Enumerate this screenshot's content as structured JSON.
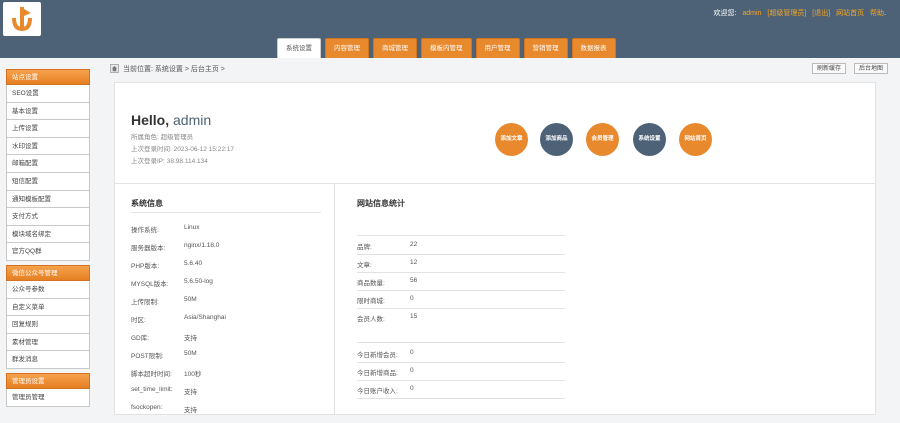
{
  "header": {
    "welcome": "欢迎您:",
    "user": "admin",
    "role_link": "[超级管理员]",
    "logout_link": "[退出]",
    "site_home_link": "网站首页",
    "help_link": "帮助"
  },
  "tabs": [
    {
      "label": "系统设置",
      "active": true
    },
    {
      "label": "内容管理"
    },
    {
      "label": "商城管理"
    },
    {
      "label": "模板内管理"
    },
    {
      "label": "用户管理"
    },
    {
      "label": "营销管理"
    },
    {
      "label": "数据报表"
    }
  ],
  "sidebar": {
    "groups": [
      {
        "title": "站点设置",
        "items": [
          "SEO设置",
          "基本设置",
          "上传设置",
          "水印设置",
          "邮箱配置",
          "短信配置",
          "通知模板配置",
          "支付方式",
          "模块域名绑定",
          "官方QQ群"
        ]
      },
      {
        "title": "微信公众号管理",
        "items": [
          "公众号参数",
          "自定义菜单",
          "回复规则",
          "素材管理",
          "群发消息"
        ]
      },
      {
        "title": "管理员设置",
        "items": [
          "管理员管理"
        ]
      }
    ]
  },
  "breadcrumb": {
    "text": "当前位置: 系统设置 > 后台主页 >",
    "btn_refresh": "刷新缓存",
    "btn_map": "后台地图"
  },
  "welcome": {
    "hello": "Hello,",
    "username": "admin",
    "role": "所属角色: 超级管理员",
    "last_login_time": "上次登录时间: 2023-06-12 15:22:17",
    "last_login_ip": "上次登录IP: 38.98.114.134"
  },
  "quick_actions": [
    {
      "label": "添加文章",
      "color": "orange"
    },
    {
      "label": "添加商品",
      "color": "slate"
    },
    {
      "label": "会员管理",
      "color": "orange"
    },
    {
      "label": "系统设置",
      "color": "slate"
    },
    {
      "label": "网站首页",
      "color": "orange"
    }
  ],
  "system_info": {
    "title": "系统信息",
    "rows": [
      {
        "k": "操作系统:",
        "v": "Linux"
      },
      {
        "k": "服务器版本:",
        "v": "nginx/1.18.0"
      },
      {
        "k": "PHP版本:",
        "v": "5.6.40"
      },
      {
        "k": "MYSQL版本:",
        "v": "5.6.50-log"
      },
      {
        "k": "上传限制:",
        "v": "50M"
      },
      {
        "k": "时区:",
        "v": "Asia/Shanghai"
      },
      {
        "k": "GD库:",
        "v": "支持"
      },
      {
        "k": "POST限制:",
        "v": "50M"
      },
      {
        "k": "脚本超时时间:",
        "v": "100秒"
      },
      {
        "k": "set_time_limit:",
        "v": "支持"
      },
      {
        "k": "fsockopen:",
        "v": "支持"
      }
    ]
  },
  "site_stats": {
    "title": "网站信息统计",
    "rows": [
      {
        "k": "品牌:",
        "v": "22"
      },
      {
        "k": "文章:",
        "v": "12"
      },
      {
        "k": "商品数量:",
        "v": "56"
      },
      {
        "k": "限时商城:",
        "v": "0"
      },
      {
        "k": "会员人数:",
        "v": "15"
      }
    ],
    "today_rows": [
      {
        "k": "今日新增会员:",
        "v": "0"
      },
      {
        "k": "今日新增商品:",
        "v": "0"
      },
      {
        "k": "今日账户收入:",
        "v": "0"
      }
    ]
  },
  "colors": {
    "header_bg": "#4e6277",
    "accent_orange": "#e8892e",
    "slate": "#4e6277"
  }
}
